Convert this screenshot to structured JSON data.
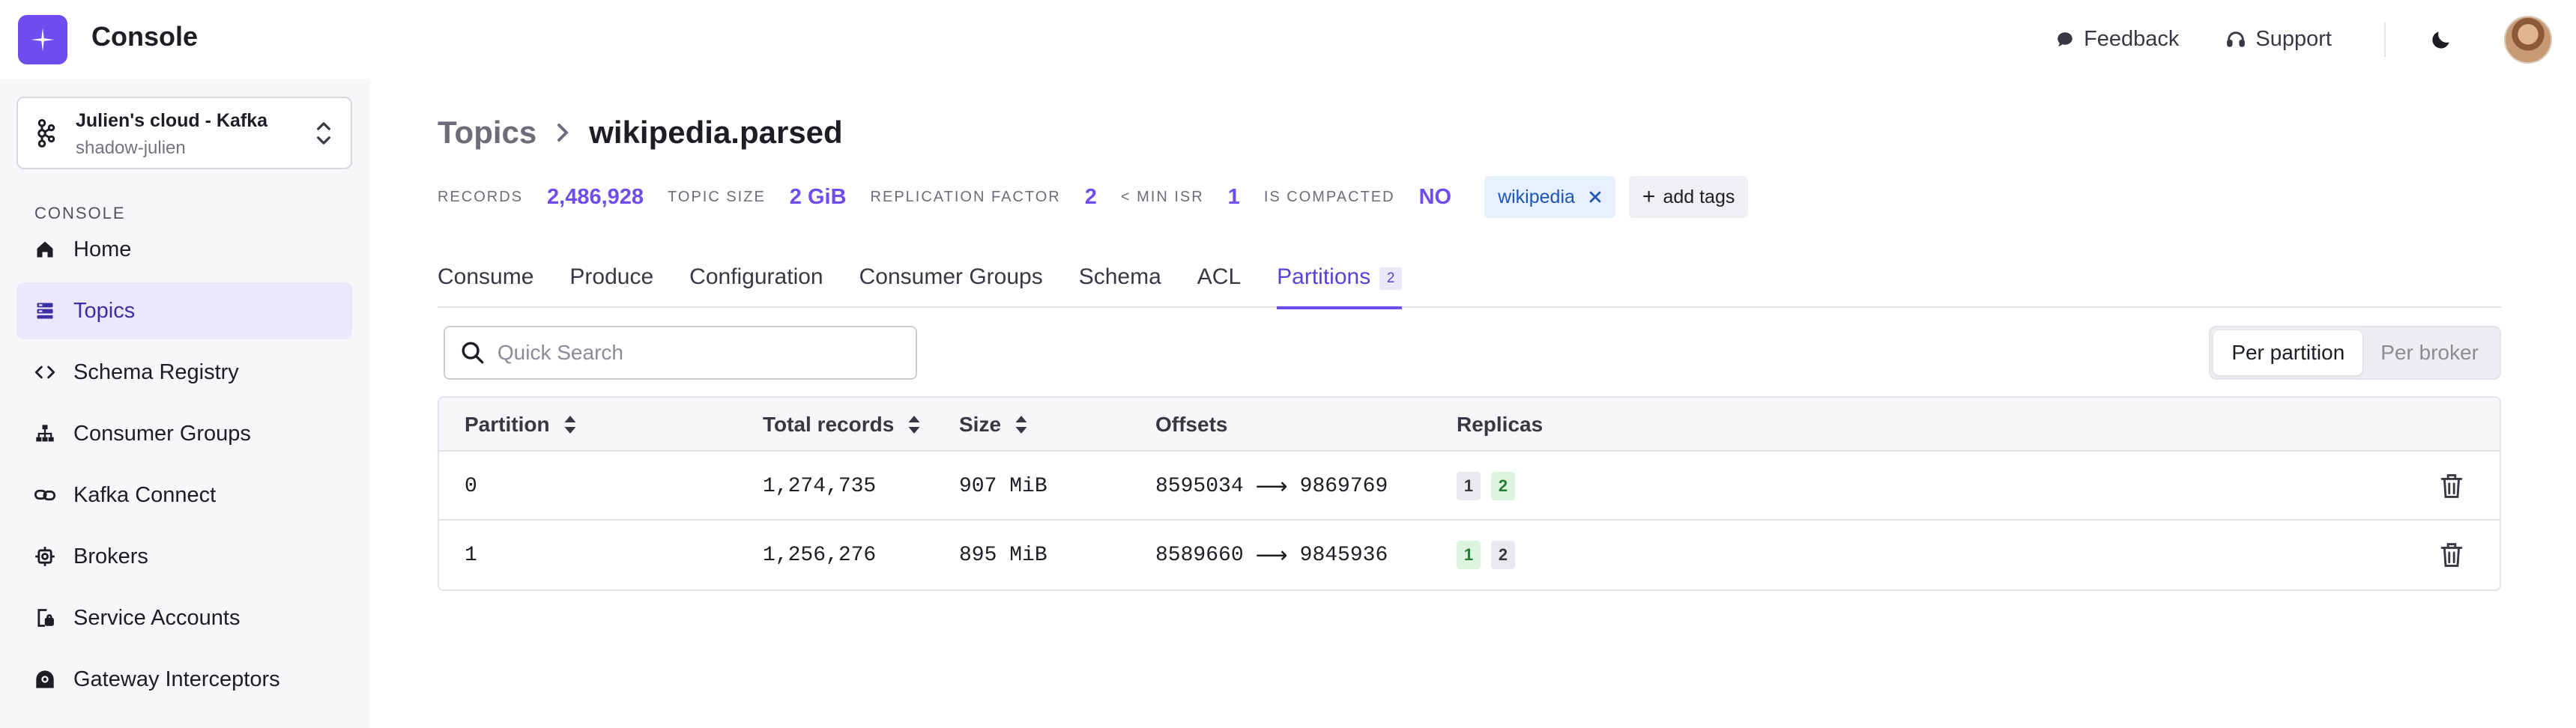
{
  "app": {
    "title": "Console"
  },
  "header": {
    "feedback_label": "Feedback",
    "support_label": "Support"
  },
  "sidebar": {
    "cluster": {
      "name": "Julien's cloud - Kafka",
      "sub": "shadow-julien"
    },
    "section_label": "CONSOLE",
    "items": [
      {
        "label": "Home",
        "icon": "home-icon",
        "active": false
      },
      {
        "label": "Topics",
        "icon": "topics-icon",
        "active": true
      },
      {
        "label": "Schema Registry",
        "icon": "code-icon",
        "active": false
      },
      {
        "label": "Consumer Groups",
        "icon": "hierarchy-icon",
        "active": false
      },
      {
        "label": "Kafka Connect",
        "icon": "link-icon",
        "active": false
      },
      {
        "label": "Brokers",
        "icon": "gear-icon",
        "active": false
      },
      {
        "label": "Service Accounts",
        "icon": "account-lock-icon",
        "active": false
      },
      {
        "label": "Gateway Interceptors",
        "icon": "gateway-icon",
        "active": false
      }
    ]
  },
  "breadcrumb": {
    "parent": "Topics",
    "current": "wikipedia.parsed"
  },
  "stats": {
    "records_label": "RECORDS",
    "records_value": "2,486,928",
    "size_label": "TOPIC SIZE",
    "size_value": "2 GiB",
    "replication_label": "REPLICATION FACTOR",
    "replication_value": "2",
    "min_isr_label": "< MIN ISR",
    "min_isr_value": "1",
    "compacted_label": "IS COMPACTED",
    "compacted_value": "NO"
  },
  "tags": {
    "items": [
      "wikipedia"
    ],
    "add_label": "add tags"
  },
  "tabs": [
    {
      "label": "Consume"
    },
    {
      "label": "Produce"
    },
    {
      "label": "Configuration"
    },
    {
      "label": "Consumer Groups"
    },
    {
      "label": "Schema"
    },
    {
      "label": "ACL"
    },
    {
      "label": "Partitions",
      "badge": "2",
      "active": true
    }
  ],
  "search": {
    "placeholder": "Quick Search",
    "value": ""
  },
  "view_toggle": {
    "options": [
      "Per partition",
      "Per broker"
    ],
    "selected": "Per partition"
  },
  "table": {
    "columns": [
      "Partition",
      "Total records",
      "Size",
      "Offsets",
      "Replicas"
    ],
    "rows": [
      {
        "partition": "0",
        "total_records": "1,274,735",
        "size": "907 MiB",
        "offset_start": "8595034",
        "offset_end": "9869769",
        "replicas": [
          {
            "id": "1",
            "leader": false
          },
          {
            "id": "2",
            "leader": true
          }
        ]
      },
      {
        "partition": "1",
        "total_records": "1,256,276",
        "size": "895 MiB",
        "offset_start": "8589660",
        "offset_end": "9845936",
        "replicas": [
          {
            "id": "1",
            "leader": true
          },
          {
            "id": "2",
            "leader": false
          }
        ]
      }
    ]
  },
  "colors": {
    "accent": "#6d4cf0",
    "active_nav_bg": "#ece7fb",
    "tag_bg": "#e6f0ff",
    "leader_green": "#dcf5df"
  }
}
